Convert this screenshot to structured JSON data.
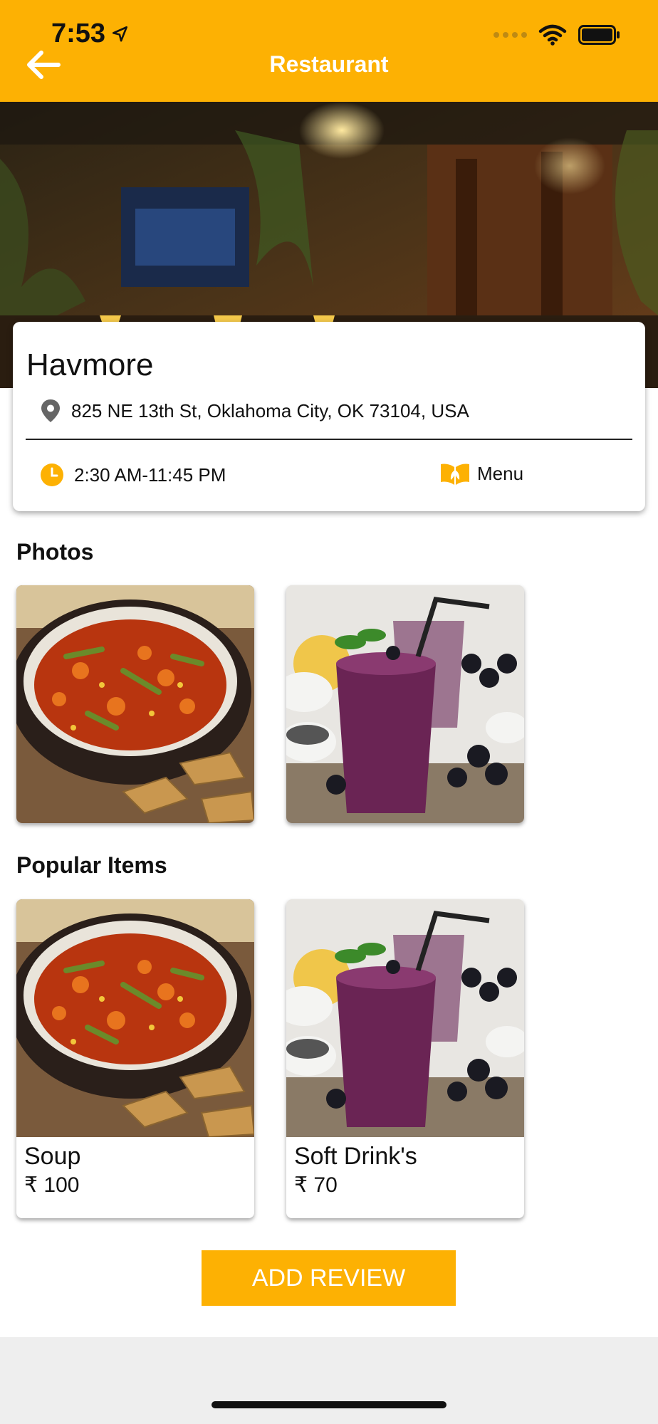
{
  "status_bar": {
    "time": "7:53"
  },
  "header": {
    "title": "Restaurant",
    "back_icon": "arrow-left-icon",
    "color": "#FDB103"
  },
  "restaurant": {
    "name": "Havmore",
    "address": "825 NE 13th St, Oklahoma City, OK 73104, USA",
    "hours": "2:30 AM-11:45 PM",
    "menu_label": "Menu"
  },
  "photos": {
    "title": "Photos",
    "items": [
      {
        "image": "vegetable-soup"
      },
      {
        "image": "berry-smoothie"
      }
    ]
  },
  "popular": {
    "title": "Popular Items",
    "items": [
      {
        "name": "Soup",
        "price": "₹ 100",
        "image": "vegetable-soup"
      },
      {
        "name": "Soft Drink's",
        "price": "₹ 70",
        "image": "berry-smoothie"
      }
    ]
  },
  "review_button": {
    "label": "ADD REVIEW"
  }
}
